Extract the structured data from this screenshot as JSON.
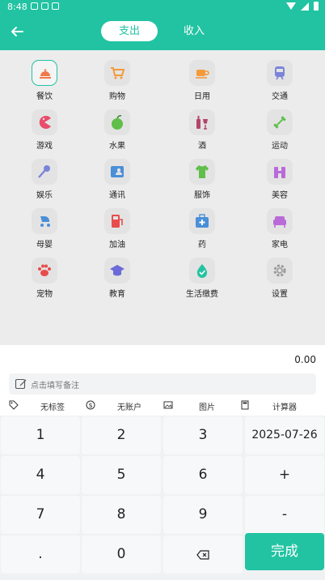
{
  "status_bar": {
    "time": "8:48"
  },
  "header": {
    "tabs": [
      {
        "label": "支出",
        "active": true
      },
      {
        "label": "收入",
        "active": false
      }
    ]
  },
  "categories": [
    {
      "label": "餐饮",
      "icon": "dining-icon",
      "color": "#f07a4a",
      "selected": true
    },
    {
      "label": "购物",
      "icon": "cart-icon",
      "color": "#f39a3a"
    },
    {
      "label": "日用",
      "icon": "cup-icon",
      "color": "#f39a3a"
    },
    {
      "label": "交通",
      "icon": "train-icon",
      "color": "#7b84d8"
    },
    {
      "label": "游戏",
      "icon": "pacman-icon",
      "color": "#e84d6c"
    },
    {
      "label": "水果",
      "icon": "apple-icon",
      "color": "#5fbf4a"
    },
    {
      "label": "酒",
      "icon": "wine-icon",
      "color": "#b2456a"
    },
    {
      "label": "运动",
      "icon": "dumbbell-icon",
      "color": "#5fbf4a"
    },
    {
      "label": "娱乐",
      "icon": "microphone-icon",
      "color": "#7b84d8"
    },
    {
      "label": "通讯",
      "icon": "contact-card-icon",
      "color": "#4a8fd8"
    },
    {
      "label": "服饰",
      "icon": "shirt-icon",
      "color": "#5fbf4a"
    },
    {
      "label": "美容",
      "icon": "beauty-icon",
      "color": "#b96ad8"
    },
    {
      "label": "母婴",
      "icon": "stroller-icon",
      "color": "#4a8fd8"
    },
    {
      "label": "加油",
      "icon": "fuel-icon",
      "color": "#e84d4d"
    },
    {
      "label": "药",
      "icon": "medkit-icon",
      "color": "#4a8fd8"
    },
    {
      "label": "家电",
      "icon": "sofa-icon",
      "color": "#b96ad8"
    },
    {
      "label": "宠物",
      "icon": "paw-icon",
      "color": "#e84d4d"
    },
    {
      "label": "教育",
      "icon": "graduation-cap-icon",
      "color": "#6a6ad8"
    },
    {
      "label": "生活缴费",
      "icon": "drop-check-icon",
      "color": "#22c3a2"
    },
    {
      "label": "设置",
      "icon": "gear-icon",
      "color": "#9a9a9a"
    }
  ],
  "amount": "0.00",
  "memo": {
    "placeholder": "点击填写备注"
  },
  "options": [
    {
      "label": "无标签",
      "icon": "tag-icon"
    },
    {
      "label": "无账户",
      "icon": "dollar-icon"
    },
    {
      "label": "图片",
      "icon": "image-icon"
    },
    {
      "label": "计算器",
      "icon": "calculator-icon"
    }
  ],
  "keypad": {
    "rows": [
      [
        "1",
        "2",
        "3",
        "2025-07-26"
      ],
      [
        "4",
        "5",
        "6",
        "+"
      ],
      [
        "7",
        "8",
        "9",
        "-"
      ],
      [
        ".",
        "0",
        "",
        ""
      ]
    ],
    "done_label": "完成"
  },
  "colors": {
    "accent": "#22c3a2",
    "grid_bg": "#ececec",
    "key_bg": "#f7f8fa"
  }
}
